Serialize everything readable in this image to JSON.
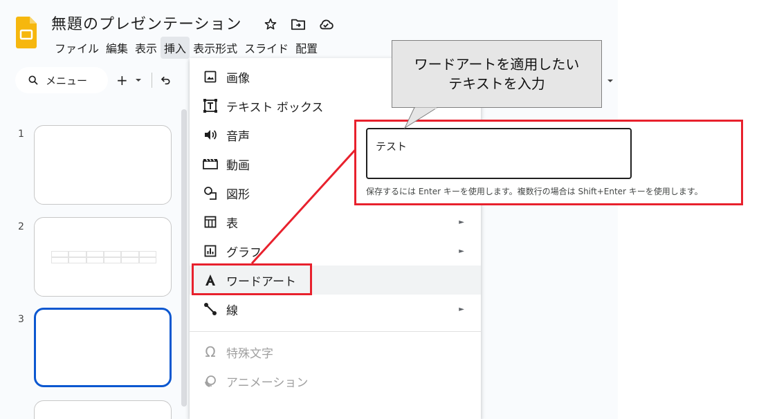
{
  "app": {
    "doc_title": "無題のプレゼンテーション",
    "accent_color": "#0b57d0",
    "logo_color": "#f6b70e",
    "highlight_color": "#e8212d"
  },
  "menubar": {
    "items": [
      "ファイル",
      "編集",
      "表示",
      "挿入",
      "表示形式",
      "スライド",
      "配置"
    ],
    "active_index": 3
  },
  "toolbar": {
    "search_label": "メニュー",
    "add_label": "+",
    "undo_icon": "undo-icon"
  },
  "filmstrip": {
    "slides": [
      {
        "number": "1",
        "content": "blank"
      },
      {
        "number": "2",
        "content": "table"
      },
      {
        "number": "3",
        "content": "blank",
        "selected": true
      }
    ]
  },
  "insert_menu": {
    "items": [
      {
        "label": "画像",
        "icon": "image-icon",
        "submenu": false
      },
      {
        "label": "テキスト ボックス",
        "icon": "text-box-icon",
        "submenu": false
      },
      {
        "label": "音声",
        "icon": "audio-icon",
        "submenu": false
      },
      {
        "label": "動画",
        "icon": "video-icon",
        "submenu": false
      },
      {
        "label": "図形",
        "icon": "shape-icon",
        "submenu": false
      },
      {
        "label": "表",
        "icon": "table-icon",
        "submenu": true
      },
      {
        "label": "グラフ",
        "icon": "chart-icon",
        "submenu": true
      },
      {
        "label": "ワードアート",
        "icon": "word-art-icon",
        "submenu": false,
        "hover": true
      },
      {
        "label": "線",
        "icon": "line-icon",
        "submenu": true
      },
      {
        "label": "特殊文字",
        "icon": "omega-icon",
        "submenu": false,
        "disabled": true
      },
      {
        "label": "アニメーション",
        "icon": "animation-icon",
        "submenu": false,
        "disabled": true
      }
    ]
  },
  "callout": {
    "line1": "ワードアートを適用したい",
    "line2": "テキストを入力"
  },
  "word_art_dialog": {
    "input_value": "テスト",
    "hint": "保存するには Enter キーを使用します。複数行の場合は Shift+Enter キーを使用します。"
  }
}
